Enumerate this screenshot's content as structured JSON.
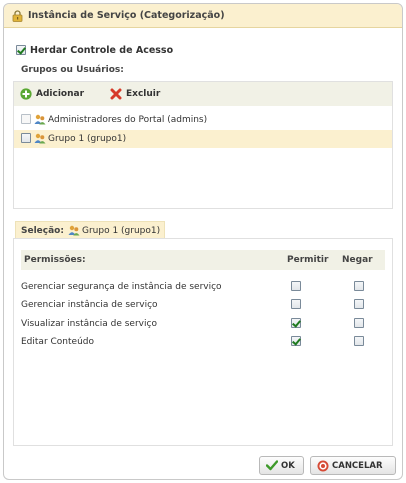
{
  "dialog": {
    "title": "Instância de Serviço (Categorização)",
    "title_icon": "lock-icon"
  },
  "inherit": {
    "label": "Herdar Controle de Acesso",
    "checked": true
  },
  "groups": {
    "label": "Grupos ou Usuários:",
    "toolbar": {
      "add_label": "Adicionar",
      "add_icon": "plus-icon",
      "remove_label": "Excluir",
      "remove_icon": "delete-x-icon"
    },
    "items": [
      {
        "label": "Administradores do Portal (admins)",
        "selected": false,
        "icon": "group-icon"
      },
      {
        "label": "Grupo 1 (grupo1)",
        "selected": true,
        "icon": "group-icon"
      }
    ]
  },
  "selection": {
    "label": "Seleção:",
    "value": "Grupo 1 (grupo1)"
  },
  "permissions": {
    "header": {
      "name": "Permissões:",
      "allow": "Permitir",
      "deny": "Negar"
    },
    "rows": [
      {
        "name": "Gerenciar segurança de instância de serviço",
        "allow": false,
        "deny": false
      },
      {
        "name": "Gerenciar instância de serviço",
        "allow": false,
        "deny": false
      },
      {
        "name": "Visualizar instância de serviço",
        "allow": true,
        "deny": false
      },
      {
        "name": "Editar Conteúdo",
        "allow": true,
        "deny": false
      }
    ]
  },
  "buttons": {
    "ok_label": "OK",
    "ok_icon": "check-icon",
    "cancel_label": "CANCELAR",
    "cancel_icon": "cancel-icon"
  },
  "colors": {
    "title_bg": "#fbf0cf",
    "toolbar_bg": "#f1f1e6",
    "selected_row_bg": "#fbf0cf",
    "check_color": "#1f7a1f"
  }
}
